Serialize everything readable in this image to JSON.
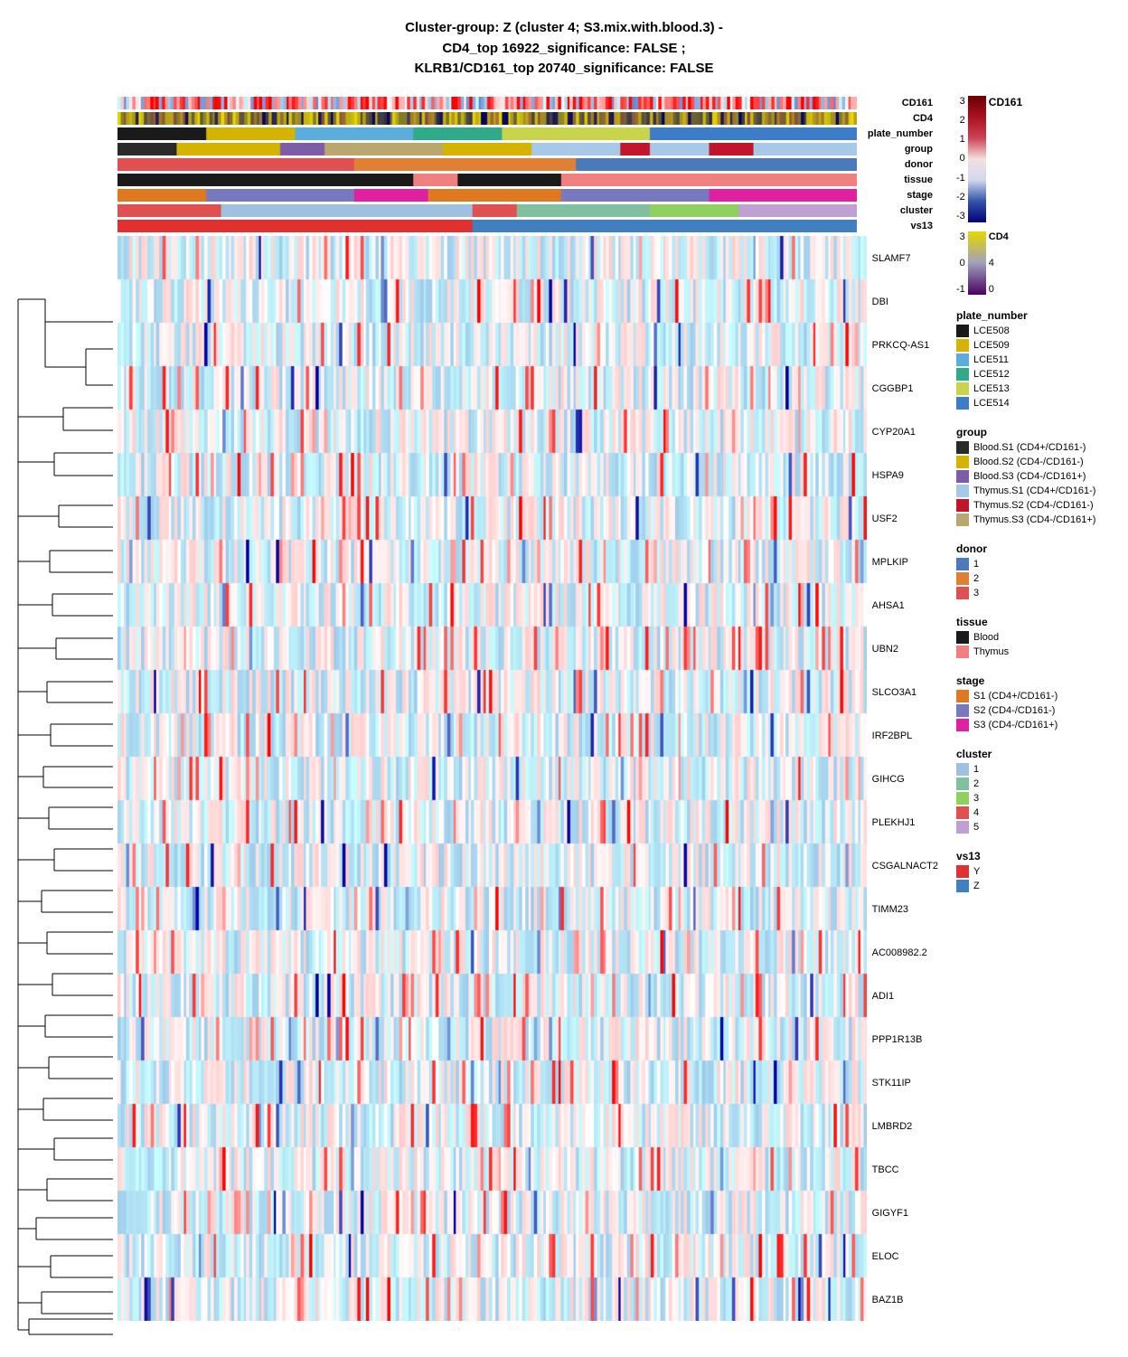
{
  "title": {
    "line1": "Cluster-group: Z (cluster 4; S3.mix.with.blood.3) -",
    "line2": "CD4_top 16922_significance: FALSE ;",
    "line3": "KLRB1/CD161_top 20740_significance: FALSE"
  },
  "annotation_labels": [
    "CD161",
    "CD4",
    "plate_number",
    "group",
    "donor",
    "tissue",
    "stage",
    "cluster",
    "vs13"
  ],
  "genes": [
    "SLAMF7",
    "DBI",
    "PRKCQ-AS1",
    "CGGBP1",
    "CYP20A1",
    "HSPA9",
    "USF2",
    "MPLKIP",
    "AHSA1",
    "UBN2",
    "SLCO3A1",
    "IRF2BPL",
    "GIHCG",
    "PLEKHJ1",
    "CSGALNACT2",
    "TIMM23",
    "AC008982.2",
    "ADI1",
    "PPP1R13B",
    "STK11IP",
    "LMBRD2",
    "TBCC",
    "GIGYF1",
    "ELOC",
    "BAZ1B"
  ],
  "legend": {
    "colorbar_title": "CD161",
    "colorbar_labels": [
      "3",
      "2",
      "1",
      "0",
      "-1",
      "-2",
      "-3"
    ],
    "cd4_title": "CD4",
    "cd4_labels": [
      "3",
      "0",
      "-1"
    ],
    "cd4_right_labels": [
      "4",
      "",
      "0"
    ],
    "plate_number_title": "plate_number",
    "plate_items": [
      {
        "label": "LCE508",
        "color": "#1a1a1a"
      },
      {
        "label": "LCE509",
        "color": "#d4b400"
      },
      {
        "label": "LCE511",
        "color": "#5aaddc"
      },
      {
        "label": "LCE512",
        "color": "#2dab8a"
      },
      {
        "label": "LCE513",
        "color": "#c8d44a"
      },
      {
        "label": "LCE514",
        "color": "#3b7dc8"
      }
    ],
    "group_title": "group",
    "group_items": [
      {
        "label": "Blood.S1 (CD4+/CD161-)",
        "color": "#2a2a2a"
      },
      {
        "label": "Blood.S2 (CD4-/CD161-)",
        "color": "#d4b400"
      },
      {
        "label": "Blood.S3 (CD4-/CD161+)",
        "color": "#7b5ea7"
      },
      {
        "label": "Thymus.S1 (CD4+/CD161-)",
        "color": "#a8c8e8"
      },
      {
        "label": "Thymus.S2 (CD4-/CD161-)",
        "color": "#c0152a"
      },
      {
        "label": "Thymus.S3 (CD4-/CD161+)",
        "color": "#b8a870"
      }
    ],
    "donor_title": "donor",
    "donor_items": [
      {
        "label": "1",
        "color": "#4a7abc"
      },
      {
        "label": "2",
        "color": "#e08030"
      },
      {
        "label": "3",
        "color": "#e05050"
      }
    ],
    "tissue_title": "tissue",
    "tissue_items": [
      {
        "label": "Blood",
        "color": "#1a1a1a"
      },
      {
        "label": "Thymus",
        "color": "#f08080"
      }
    ],
    "stage_title": "stage",
    "stage_items": [
      {
        "label": "S1 (CD4+/CD161-)",
        "color": "#e07820"
      },
      {
        "label": "S2 (CD4-/CD161-)",
        "color": "#7878c0"
      },
      {
        "label": "S3 (CD4-/CD161+)",
        "color": "#e020a0"
      }
    ],
    "cluster_title": "cluster",
    "cluster_items": [
      {
        "label": "1",
        "color": "#a0c0e0"
      },
      {
        "label": "2",
        "color": "#80c0a0"
      },
      {
        "label": "3",
        "color": "#90d060"
      },
      {
        "label": "4",
        "color": "#e05050"
      },
      {
        "label": "5",
        "color": "#c0a0d0"
      }
    ],
    "vs13_title": "vs13",
    "vs13_items": [
      {
        "label": "Y",
        "color": "#e03030"
      },
      {
        "label": "Z",
        "color": "#4080c0"
      }
    ]
  }
}
